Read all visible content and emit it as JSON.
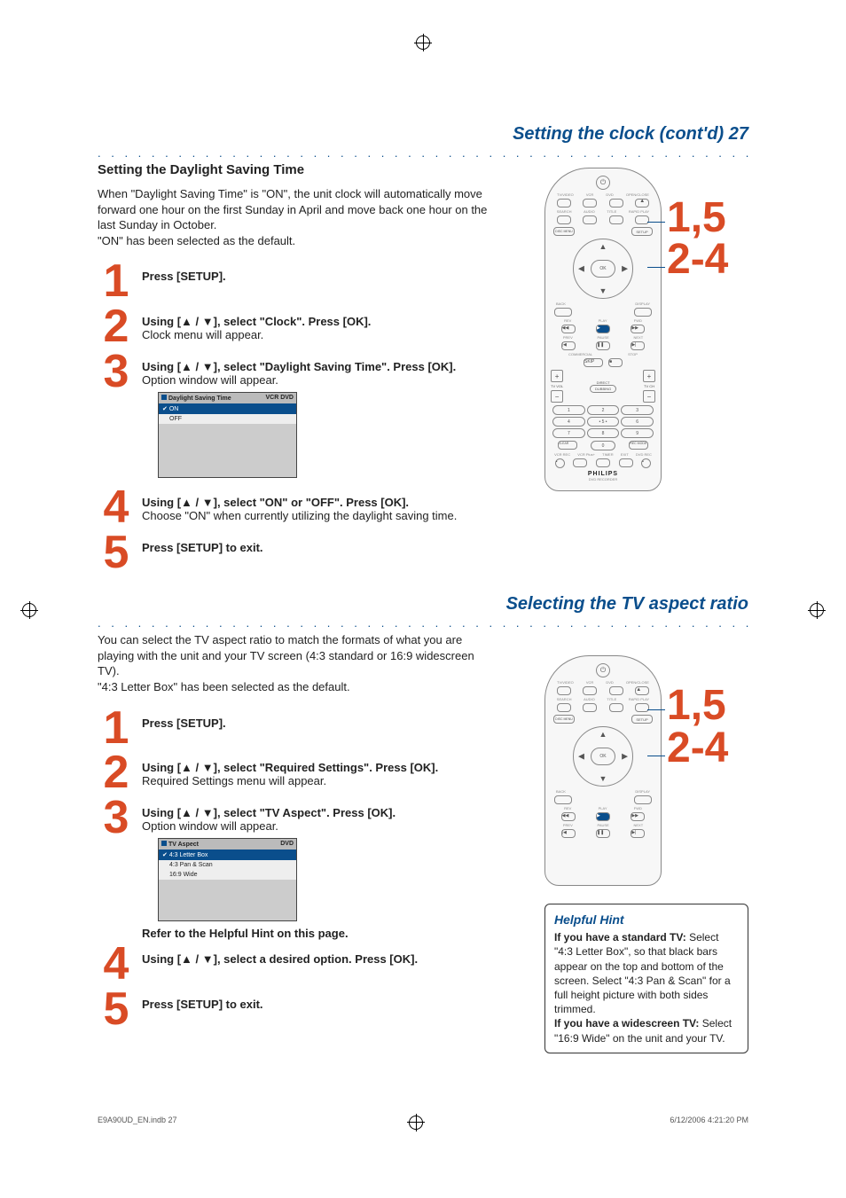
{
  "header1": "Setting the clock (cont'd)  27",
  "section1_heading": "Setting the Daylight Saving Time",
  "section1_intro": "When \"Daylight Saving Time\" is \"ON\", the unit clock will automatically move forward one hour on the first Sunday in April and move back one hour on the last Sunday in October.\n\"ON\" has been selected as the default.",
  "s1": {
    "step1": "Press [SETUP].",
    "step2a": "Using [▲ / ▼], select \"Clock\". Press [OK].",
    "step2b": "Clock menu will appear.",
    "step3a": "Using [▲ / ▼], select \"Daylight Saving Time\". Press [OK].",
    "step3b": "Option window will appear.",
    "step4a": "Using [▲ / ▼], select \"ON\" or \"OFF\". Press [OK].",
    "step4b": "Choose \"ON\" when currently utilizing the daylight saving time.",
    "step5": "Press [SETUP] to exit."
  },
  "optwin1": {
    "title": "Daylight Saving Time",
    "badge": "VCR  DVD",
    "opt1": "ON",
    "opt2": "OFF"
  },
  "callout_top": "1,5",
  "callout_bottom": "2-4",
  "header2": "Selecting the TV aspect ratio",
  "section2_intro": "You can select the TV aspect ratio to match the formats of what you are playing with the unit and your TV screen (4:3 standard or 16:9 widescreen TV).\n\"4:3 Letter Box\" has been selected as the default.",
  "s2": {
    "step1": "Press [SETUP].",
    "step2a": "Using [▲ / ▼], select \"Required Settings\". Press [OK].",
    "step2b": "Required Settings menu will appear.",
    "step3a": "Using [▲ / ▼], select \"TV Aspect\". Press [OK].",
    "step3b": "Option window will appear.",
    "step3c": "Refer to the Helpful Hint on this page.",
    "step4": "Using [▲ / ▼], select a desired option. Press [OK].",
    "step5": "Press [SETUP] to exit."
  },
  "optwin2": {
    "title": "TV Aspect",
    "badge": "DVD",
    "opt1": "4:3 Letter Box",
    "opt2": "4:3 Pan & Scan",
    "opt3": "16:9 Wide"
  },
  "hint": {
    "title": "Helpful Hint",
    "line1b": "If you have a standard TV:",
    "body1": "Select \"4:3 Letter Box\", so that black bars appear on the top and bottom of the screen. Select \"4:3 Pan & Scan\" for a full height picture with both sides trimmed.",
    "line2b": "If you have a widescreen TV:",
    "body2": "Select \"16:9 Wide\" on the unit and your TV."
  },
  "remote": {
    "ok": "OK",
    "setup": "SETUP",
    "discmenu": "DISC MENU",
    "back": "BACK",
    "display": "DISPLAY",
    "rev": "REV",
    "play": "PLAY",
    "fwd": "FWD",
    "prev": "PREV",
    "pause": "PAUSE",
    "next": "NEXT",
    "commercial": "COMMERCIAL",
    "stop": "STOP",
    "skip": "SKIP",
    "tvvol": "TV VOL",
    "direct": "DIRECT",
    "dubbing": "DUBBING",
    "clear": "CLEAR",
    "recmode": "REC MODE",
    "vcrrec": "VCR REC",
    "vcrplus": "VCR Plus+",
    "timer": "TIMER",
    "exit": "EXIT",
    "dvdrec": "DVD REC",
    "brand": "PHILIPS",
    "sub": "DVD RECORDER",
    "row1": {
      "a": "TV/VIDEO",
      "b": "VCR",
      "c": "DVD",
      "d": "OPEN/CLOSE"
    },
    "row2": {
      "a": "SEARCH",
      "b": "AUDIO",
      "c": "TITLE",
      "d": "RAPID PLAY"
    }
  },
  "footer": {
    "left": "E9A90UD_EN.indb   27",
    "right": "6/12/2006   4:21:20 PM"
  }
}
